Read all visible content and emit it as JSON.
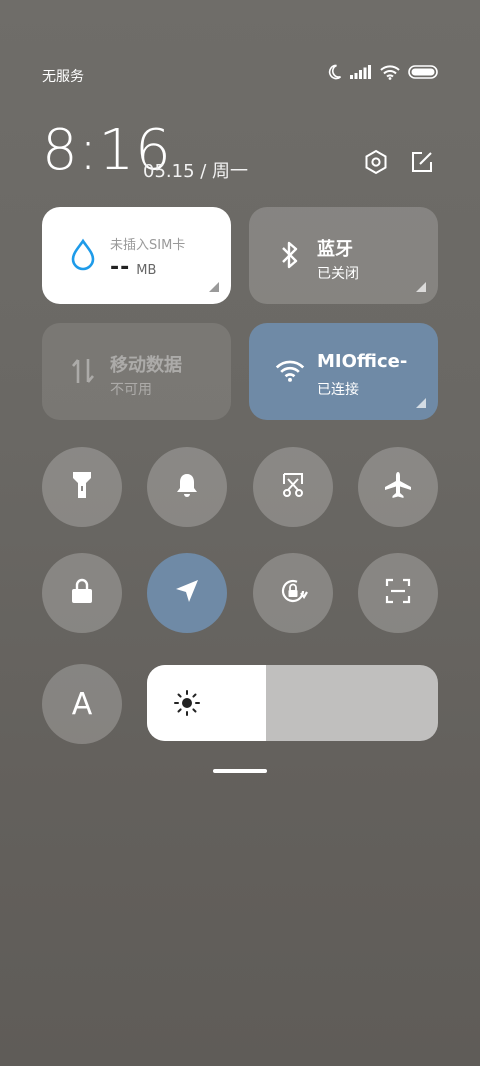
{
  "status_bar": {
    "carrier_text": "无服务",
    "icons": [
      "moon-icon",
      "signal-icon",
      "wifi-icon",
      "battery-icon"
    ]
  },
  "header": {
    "time": "8:16",
    "date": "05.15 / 周一",
    "buttons": [
      "settings-icon",
      "edit-icon"
    ]
  },
  "tiles": {
    "data": {
      "title": "未插入SIM卡",
      "value": "--",
      "unit": "MB",
      "icon": "water-drop-icon",
      "accent": "#1e9be9"
    },
    "bluetooth": {
      "title": "蓝牙",
      "status": "已关闭",
      "icon": "bluetooth-icon"
    },
    "mobile_data": {
      "title": "移动数据",
      "status": "不可用",
      "icon": "data-arrows-icon"
    },
    "wifi": {
      "title": "MIOffice-",
      "status": "已连接",
      "icon": "wifi-icon",
      "color": "#6f8aa6"
    }
  },
  "toggles_row1": [
    "flashlight-icon",
    "bell-icon",
    "screenshot-scissors-icon",
    "airplane-icon"
  ],
  "toggles_row2": [
    "lock-icon",
    "location-icon",
    "rotation-lock-icon",
    "scan-icon"
  ],
  "auto_brightness": {
    "label": "A"
  },
  "brightness": {
    "level": 0.41
  }
}
